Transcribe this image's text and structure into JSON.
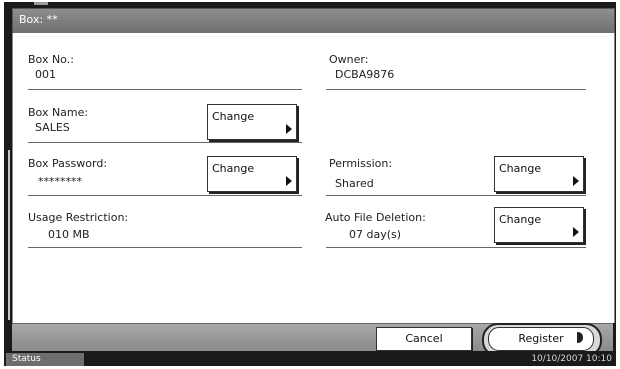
{
  "title": "Box: **",
  "fields": {
    "box_no": {
      "label": "Box No.:",
      "value": "001"
    },
    "owner": {
      "label": "Owner:",
      "value": "DCBA9876"
    },
    "box_name": {
      "label": "Box Name:",
      "value": "SALES"
    },
    "box_password": {
      "label": "Box Password:",
      "value": "********"
    },
    "permission": {
      "label": "Permission:",
      "value": "Shared"
    },
    "usage_restriction": {
      "label": "Usage Restriction:",
      "value": "010 MB"
    },
    "auto_file_deletion": {
      "label": "Auto File Deletion:",
      "value": "07 day(s)"
    }
  },
  "buttons": {
    "change": "Change",
    "cancel": "Cancel",
    "register": "Register"
  },
  "status": {
    "label": "Status",
    "datetime": "10/10/2007  10:10"
  }
}
